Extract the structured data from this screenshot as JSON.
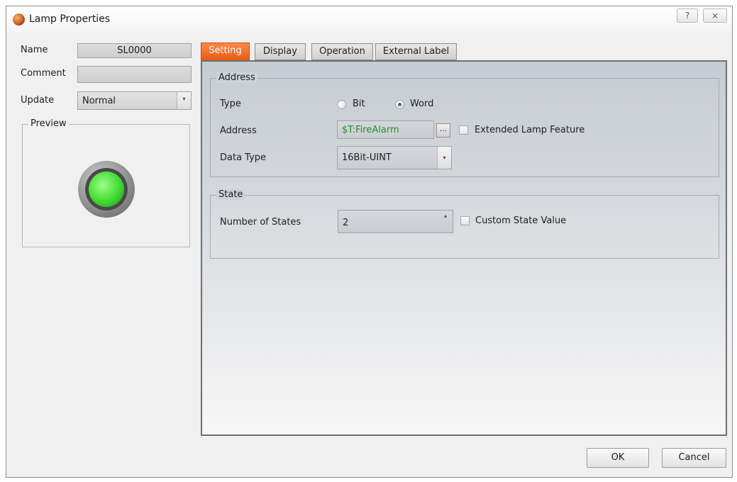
{
  "window": {
    "title": "Lamp Properties",
    "help_glyph": "?",
    "close_glyph": "⨯"
  },
  "left": {
    "name_label": "Name",
    "name_value": "SL0000",
    "comment_label": "Comment",
    "comment_value": "",
    "update_label": "Update",
    "update_value": "Normal",
    "preview_label": "Preview"
  },
  "tabs": [
    {
      "label": "Setting",
      "active": true
    },
    {
      "label": "Display",
      "active": false
    },
    {
      "label": "Operation",
      "active": false
    },
    {
      "label": "External Label",
      "active": false
    }
  ],
  "address_group": {
    "title": "Address",
    "type_label": "Type",
    "type_options": [
      "Bit",
      "Word"
    ],
    "type_selected": "Word",
    "address_label": "Address",
    "address_value": "$T:FireAlarm",
    "browse_label": "...",
    "extended_label": "Extended Lamp Feature",
    "extended_checked": false,
    "data_type_label": "Data Type",
    "data_type_value": "16Bit-UINT"
  },
  "state_group": {
    "title": "State",
    "num_states_label": "Number of States",
    "num_states_value": "2",
    "custom_state_label": "Custom State Value",
    "custom_state_checked": false
  },
  "buttons": {
    "ok": "OK",
    "cancel": "Cancel"
  },
  "colors": {
    "active_tab": "#e65a12",
    "address_text": "#2a8a2a",
    "lamp_green": "#3fdc2f"
  },
  "icons": {
    "title": "lamp-app-icon",
    "help": "help-icon",
    "close": "close-icon",
    "dropdown": "chevron-down-icon",
    "spin": "spin-up-icon"
  }
}
